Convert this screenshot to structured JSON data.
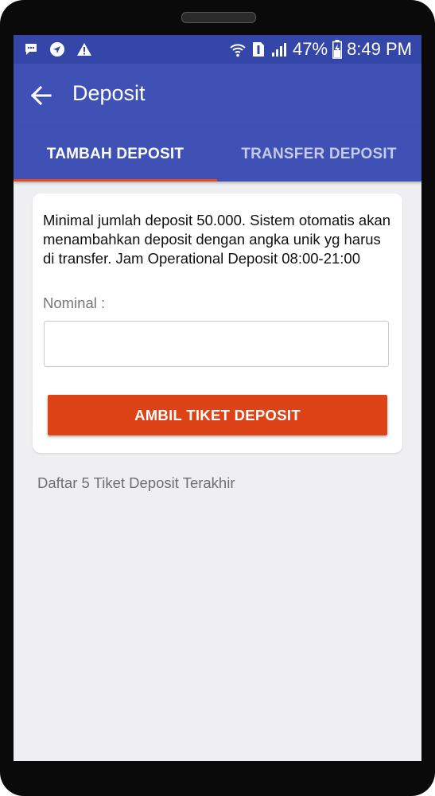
{
  "status_bar": {
    "battery": "47%",
    "time": "8:49 PM",
    "icons": [
      "message-icon",
      "navigation-icon",
      "warning-icon",
      "wifi-icon",
      "sim-icon",
      "signal-icon",
      "battery-icon"
    ]
  },
  "app_bar": {
    "title": "Deposit",
    "back_icon": "back-arrow-icon"
  },
  "tabs": [
    {
      "label": "TAMBAH DEPOSIT",
      "selected": true
    },
    {
      "label": "TRANSFER DEPOSIT",
      "selected": false
    }
  ],
  "form": {
    "info_text": "Minimal jumlah deposit 50.000. Sistem  otomatis akan menambahkan deposit dengan angka unik yg harus di transfer. Jam Operational Deposit 08:00-21:00",
    "nominal_label": "Nominal :",
    "nominal_value": "",
    "submit_label": "AMBIL TIKET DEPOSIT"
  },
  "history_title": "Daftar 5 Tiket Deposit Terakhir",
  "colors": {
    "status_bar": "#3447a8",
    "primary": "#3f51b5",
    "accent": "#e64a19",
    "button": "#dd4316",
    "background": "#efeff1"
  }
}
